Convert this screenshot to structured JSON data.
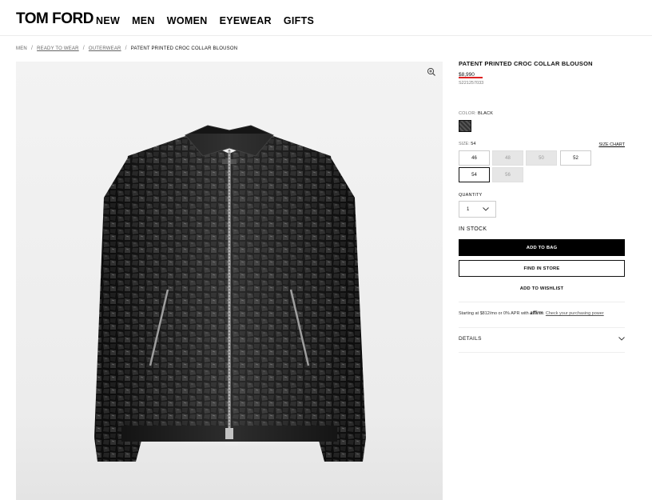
{
  "header": {
    "logo": "TOM FORD",
    "nav": [
      "NEW",
      "MEN",
      "WOMEN",
      "EYEWEAR",
      "GIFTS"
    ]
  },
  "breadcrumb": {
    "items": [
      "MEN",
      "READY TO WEAR",
      "OUTERWEAR"
    ],
    "current": "PATENT PRINTED CROC COLLAR BLOUSON"
  },
  "product": {
    "title": "PATENT PRINTED CROC COLLAR BLOUSON",
    "price": "$8,990",
    "sku": "S221257033",
    "color_label": "COLOR:",
    "color_value": "BLACK",
    "size_label": "SIZE:",
    "size_value": "54",
    "size_chart": "SIZE CHART",
    "sizes": [
      {
        "label": "46",
        "state": "available"
      },
      {
        "label": "48",
        "state": "unavailable"
      },
      {
        "label": "50",
        "state": "unavailable"
      },
      {
        "label": "52",
        "state": "available"
      },
      {
        "label": "54",
        "state": "selected"
      },
      {
        "label": "56",
        "state": "unavailable"
      }
    ],
    "quantity_label": "QUANTITY",
    "quantity_value": "1",
    "stock": "IN STOCK",
    "add_to_bag": "ADD TO BAG",
    "find_in_store": "FIND IN STORE",
    "add_to_wishlist": "ADD TO WISHLIST",
    "financing_text": "Starting at $812/mo or 0% APR with",
    "financing_brand": "affirm",
    "financing_link": "Check your purchasing power",
    "details": "DETAILS"
  },
  "icons": {
    "zoom": "zoom-in-icon",
    "chevron": "chevron-down-icon"
  }
}
